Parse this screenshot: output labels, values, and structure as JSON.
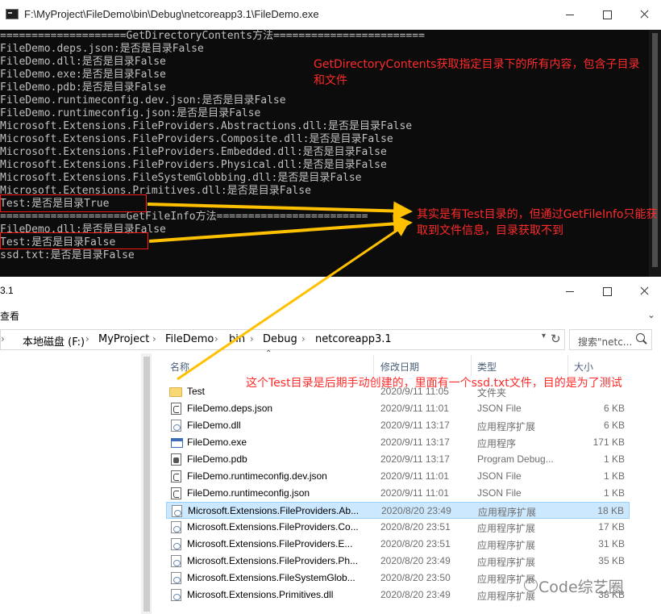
{
  "console": {
    "title": "F:\\MyProject\\FileDemo\\bin\\Debug\\netcoreapp3.1\\FileDemo.exe",
    "lines": [
      "====================GetDirectoryContents方法========================",
      "FileDemo.deps.json:是否是目录False",
      "FileDemo.dll:是否是目录False",
      "FileDemo.exe:是否是目录False",
      "FileDemo.pdb:是否是目录False",
      "FileDemo.runtimeconfig.dev.json:是否是目录False",
      "FileDemo.runtimeconfig.json:是否是目录False",
      "Microsoft.Extensions.FileProviders.Abstractions.dll:是否是目录False",
      "Microsoft.Extensions.FileProviders.Composite.dll:是否是目录False",
      "Microsoft.Extensions.FileProviders.Embedded.dll:是否是目录False",
      "Microsoft.Extensions.FileProviders.Physical.dll:是否是目录False",
      "Microsoft.Extensions.FileSystemGlobbing.dll:是否是目录False",
      "Microsoft.Extensions.Primitives.dll:是否是目录False",
      "Test:是否是目录True",
      "====================GetFileInfo方法========================",
      "FileDemo.dll:是否是目录False",
      "Test:是否是目录False",
      "ssd.txt:是否是目录False"
    ]
  },
  "explorer": {
    "title": "3.1",
    "view_tab": "查看",
    "breadcrumb": [
      "本地磁盘 (F:)",
      "MyProject",
      "FileDemo",
      "bin",
      "Debug",
      "netcoreapp3.1"
    ],
    "search_placeholder": "搜索\"netc...",
    "columns": {
      "name": "名称",
      "date": "修改日期",
      "type": "类型",
      "size": "大小"
    },
    "files": [
      {
        "name": "Test",
        "date": "2020/9/11 11:05",
        "type": "文件夹",
        "size": "",
        "icon": "folder-icon"
      },
      {
        "name": "FileDemo.deps.json",
        "date": "2020/9/11 11:01",
        "type": "JSON File",
        "size": "6 KB",
        "icon": "json-file-icon"
      },
      {
        "name": "FileDemo.dll",
        "date": "2020/9/11 13:17",
        "type": "应用程序扩展",
        "size": "6 KB",
        "icon": "dll-file-icon"
      },
      {
        "name": "FileDemo.exe",
        "date": "2020/9/11 13:17",
        "type": "应用程序",
        "size": "171 KB",
        "icon": "exe-file-icon"
      },
      {
        "name": "FileDemo.pdb",
        "date": "2020/9/11 13:17",
        "type": "Program Debug...",
        "size": "1 KB",
        "icon": "pdb-file-icon"
      },
      {
        "name": "FileDemo.runtimeconfig.dev.json",
        "date": "2020/9/11 11:01",
        "type": "JSON File",
        "size": "1 KB",
        "icon": "json-file-icon"
      },
      {
        "name": "FileDemo.runtimeconfig.json",
        "date": "2020/9/11 11:01",
        "type": "JSON File",
        "size": "1 KB",
        "icon": "json-file-icon"
      },
      {
        "name": "Microsoft.Extensions.FileProviders.Ab...",
        "date": "2020/8/20 23:49",
        "type": "应用程序扩展",
        "size": "18 KB",
        "icon": "dll-file-icon",
        "selected": true
      },
      {
        "name": "Microsoft.Extensions.FileProviders.Co...",
        "date": "2020/8/20 23:51",
        "type": "应用程序扩展",
        "size": "17 KB",
        "icon": "dll-file-icon"
      },
      {
        "name": "Microsoft.Extensions.FileProviders.E...",
        "date": "2020/8/20 23:51",
        "type": "应用程序扩展",
        "size": "31 KB",
        "icon": "dll-file-icon"
      },
      {
        "name": "Microsoft.Extensions.FileProviders.Ph...",
        "date": "2020/8/20 23:49",
        "type": "应用程序扩展",
        "size": "35 KB",
        "icon": "dll-file-icon"
      },
      {
        "name": "Microsoft.Extensions.FileSystemGlob...",
        "date": "2020/8/20 23:50",
        "type": "应用程序扩展",
        "size": "",
        "icon": "dll-file-icon"
      },
      {
        "name": "Microsoft.Extensions.Primitives.dll",
        "date": "2020/8/20 23:49",
        "type": "应用程序扩展",
        "size": "38 KB",
        "icon": "dll-file-icon"
      }
    ]
  },
  "annotations": {
    "note1": "GetDirectoryContents获取指定目录下的所有内容，包含子目录和文件",
    "note2": "其实是有Test目录的，但通过GetFileInfo只能获取到文件信息，目录获取不到",
    "note3": "这个Test目录是后期手动创建的，里面有一个ssd.txt文件，目的是为了测试",
    "color": "#ff2a2a",
    "arrow_color": "#ffc000"
  },
  "watermark": "Code综艺圈"
}
